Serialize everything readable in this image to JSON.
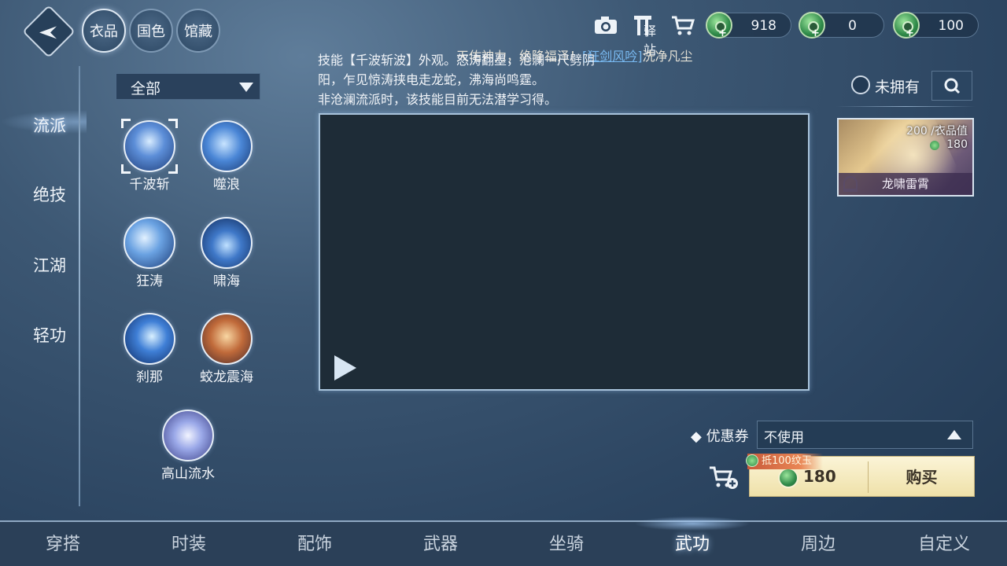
{
  "header": {
    "top_tabs": [
      "衣品",
      "国色",
      "馆藏"
    ],
    "icons": [
      "camera-icon",
      "post-station-icon",
      "cart-icon"
    ],
    "post_station_label": "驿站",
    "currencies": [
      {
        "name": "jade-coin",
        "value": "918"
      },
      {
        "name": "jade-coin",
        "value": "0"
      },
      {
        "name": "jade-coin",
        "value": "100"
      }
    ]
  },
  "sidebar": {
    "items": [
      {
        "label": "流派",
        "active": true
      },
      {
        "label": "绝技",
        "active": false
      },
      {
        "label": "江湖",
        "active": false
      },
      {
        "label": "轻功",
        "active": false
      }
    ]
  },
  "filter": {
    "label": "全部"
  },
  "skills": [
    {
      "name": "千波斩",
      "selected": true
    },
    {
      "name": "噬浪",
      "selected": false
    },
    {
      "name": "狂涛",
      "selected": false
    },
    {
      "name": "啸海",
      "selected": false
    },
    {
      "name": "刹那",
      "selected": false
    },
    {
      "name": "蛟龙震海",
      "selected": false
    },
    {
      "name": "高山流水",
      "selected": false
    }
  ],
  "banner": {
    "text": "天佑神力，绝降福泽！",
    "highlight": "[狂剑风吟]",
    "suffix": "洗净凡尘"
  },
  "description": {
    "line1": "技能【千波斩波】外观。怒涛翻墨，沧澜一尺劈阴",
    "line2": "阳，乍见惊涛挟电走龙蛇，沸海尚鸣霆。",
    "line3": "非沧澜流派时，该技能目前无法潜学习得。"
  },
  "filter_owned": {
    "label": "未拥有",
    "checked": false
  },
  "item_card": {
    "name": "龙啸雷霄",
    "cost_label": "200 /衣品值",
    "price": "180"
  },
  "coupon": {
    "label": "优惠券",
    "value": "不使用"
  },
  "purchase": {
    "discount_tag": "抵100纹玉",
    "price": "180",
    "buy_label": "购买"
  },
  "bottom_nav": [
    {
      "label": "穿搭",
      "active": false
    },
    {
      "label": "时装",
      "active": false
    },
    {
      "label": "配饰",
      "active": false
    },
    {
      "label": "武器",
      "active": false
    },
    {
      "label": "坐骑",
      "active": false
    },
    {
      "label": "武功",
      "active": true
    },
    {
      "label": "周边",
      "active": false
    },
    {
      "label": "自定义",
      "active": false
    }
  ]
}
